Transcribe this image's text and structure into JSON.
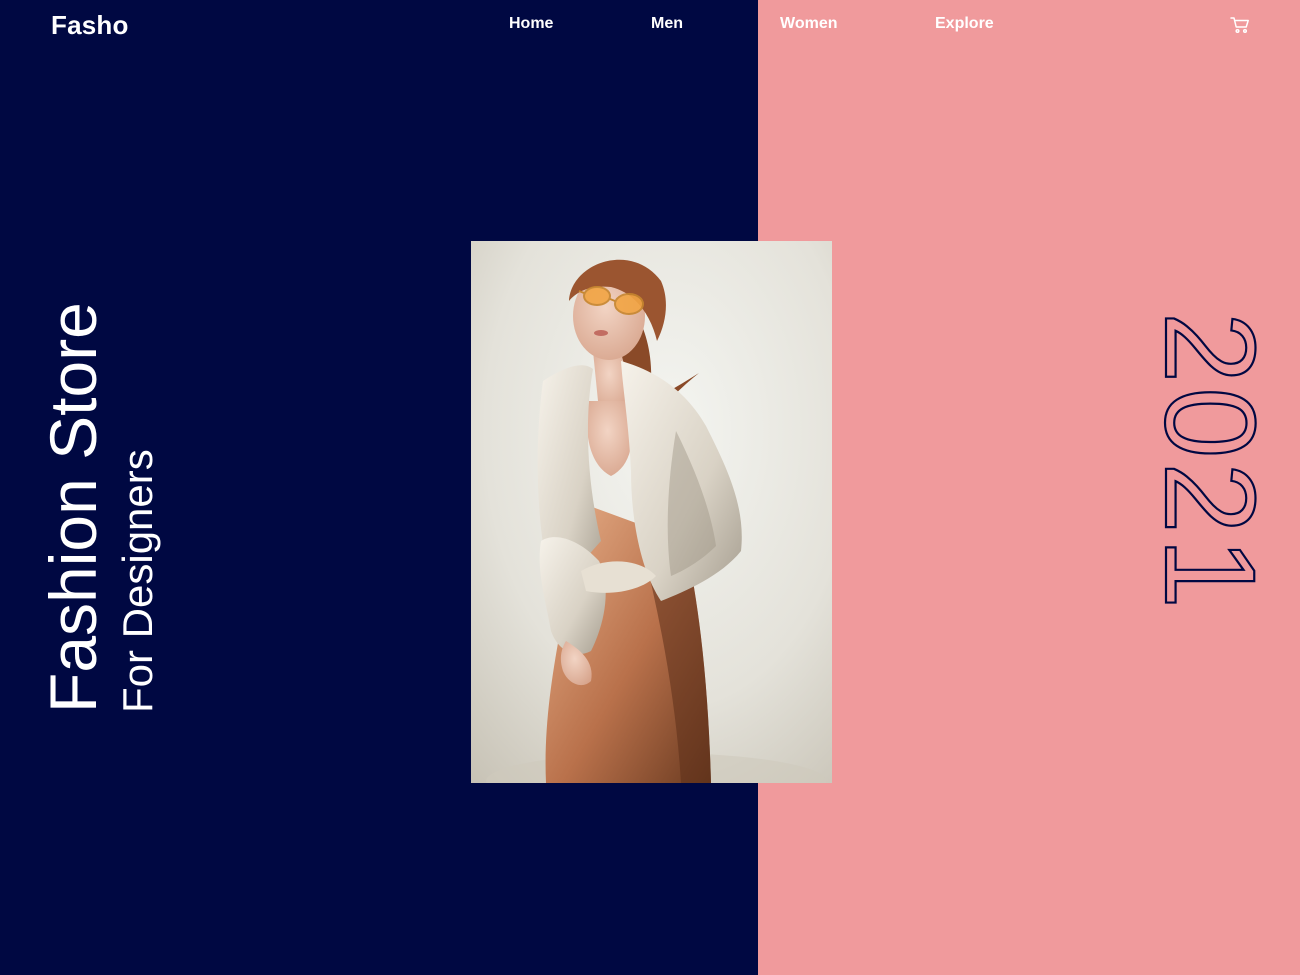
{
  "brand": {
    "name": "Fasho"
  },
  "nav": {
    "items": [
      {
        "label": "Home"
      },
      {
        "label": "Men"
      },
      {
        "label": "Women"
      },
      {
        "label": "Explore"
      }
    ],
    "cart_icon": "cart-icon"
  },
  "hero": {
    "title": "Fashion Store",
    "subtitle": "For Designers",
    "year": "2021",
    "image_alt": "Model wearing orange sunglasses and an oversized white shirt"
  },
  "colors": {
    "navy": "#000842",
    "pink": "#f09a9c",
    "white": "#ffffff"
  }
}
